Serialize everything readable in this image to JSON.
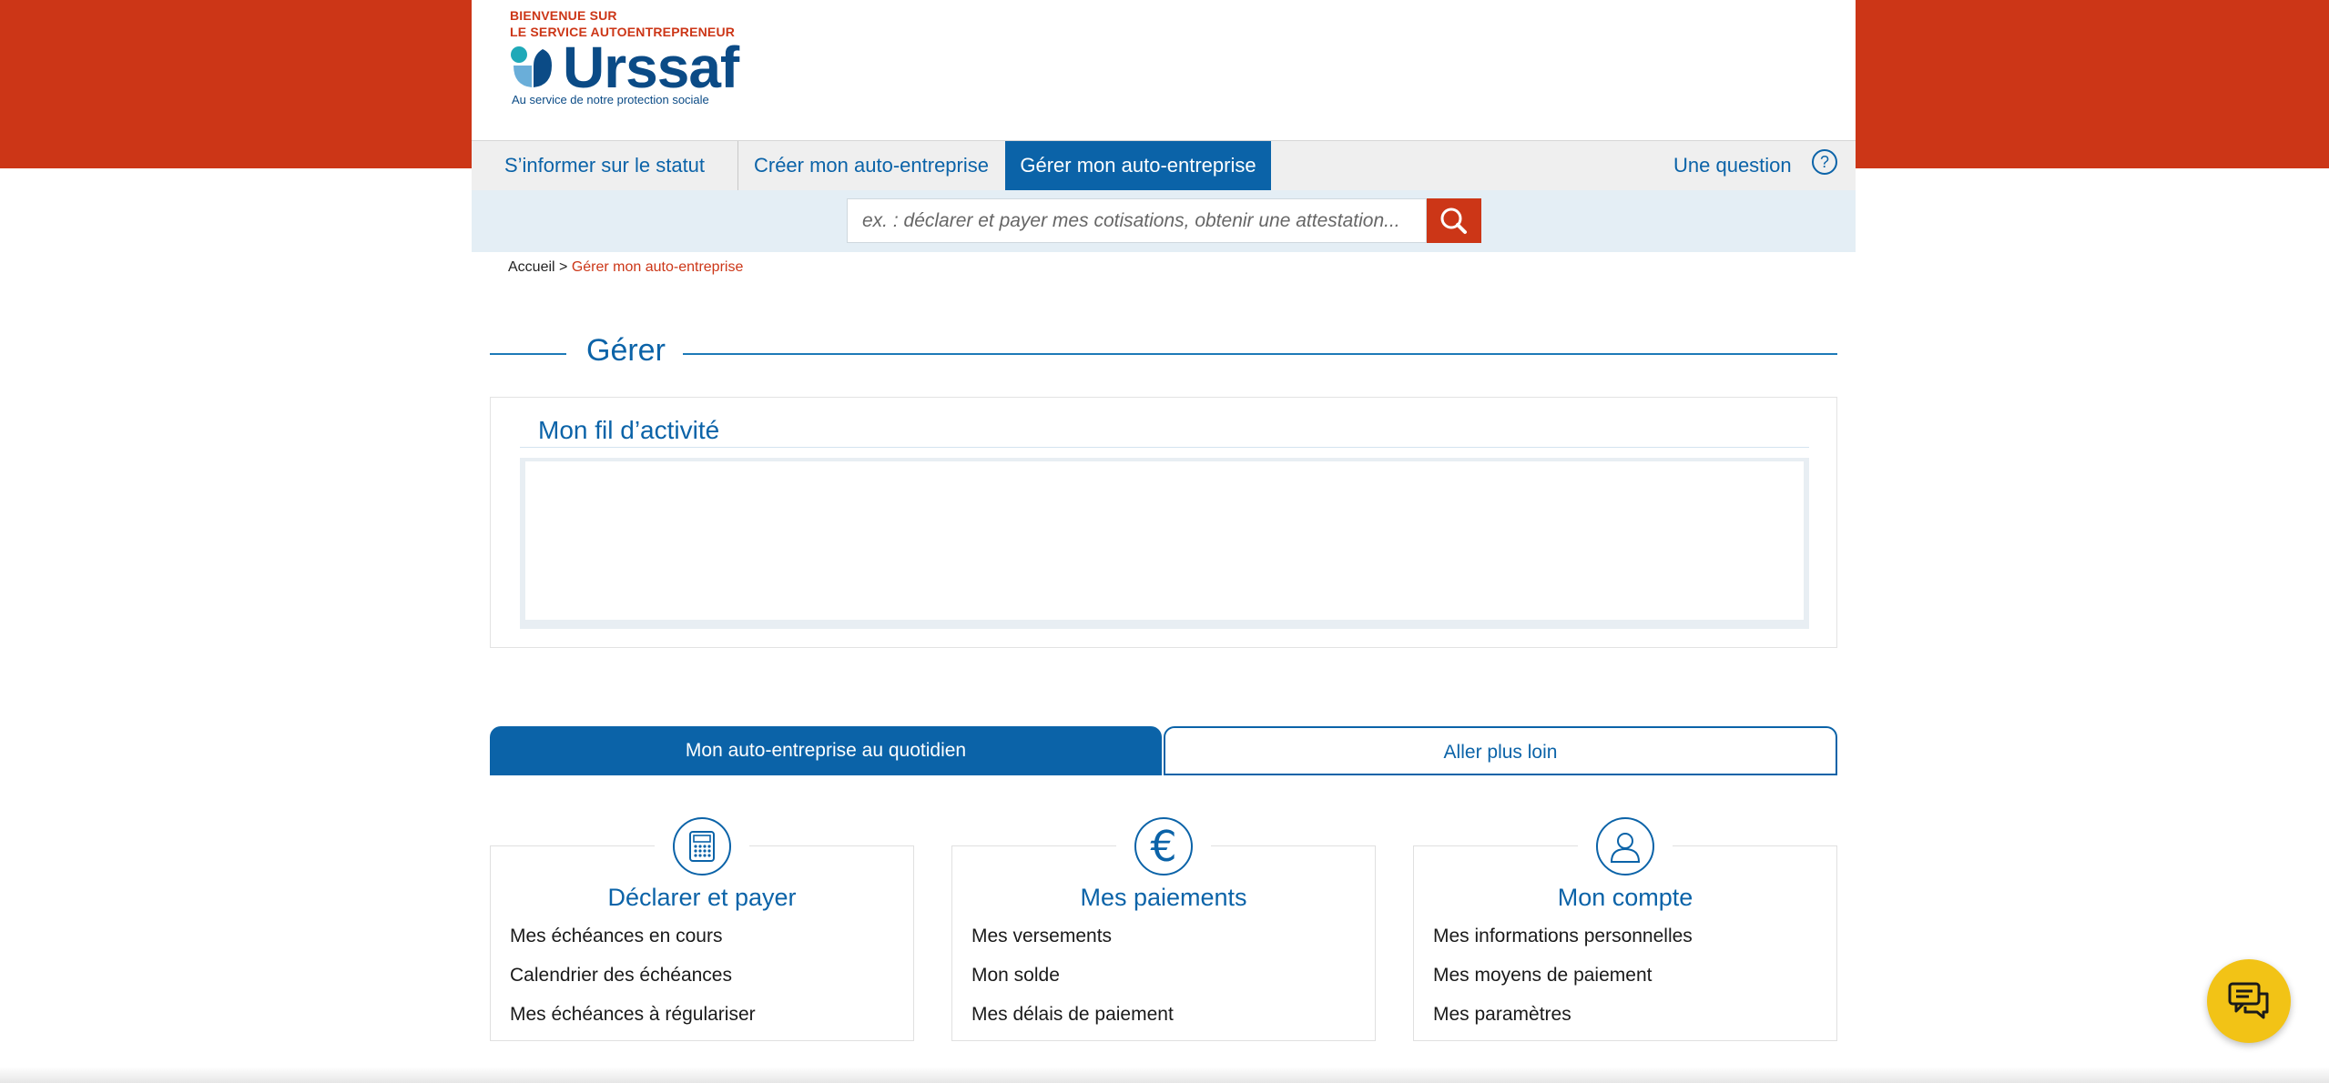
{
  "colors": {
    "brand_red": "#cc3617",
    "brand_blue": "#0b63a8",
    "chat_yellow": "#f2c316"
  },
  "header": {
    "welcome_line1": "BIENVENUE SUR",
    "welcome_line2": "LE SERVICE AUTOENTREPRENEUR",
    "logo_text": "Urssaf",
    "logo_tagline": "Au service de notre protection sociale"
  },
  "nav": {
    "items": [
      {
        "label": "S’informer sur le statut"
      },
      {
        "label": "Créer mon auto-entreprise"
      },
      {
        "label": "Gérer mon auto-entreprise",
        "active": true
      }
    ],
    "help_label": "Une question",
    "help_icon": "question-circle-icon"
  },
  "search": {
    "placeholder": "ex. : déclarer et payer mes cotisations, obtenir une attestation...",
    "icon": "search-icon"
  },
  "breadcrumb": {
    "home": "Accueil",
    "separator": ">",
    "current": "Gérer mon auto-entreprise"
  },
  "main": {
    "section_title": "Gérer",
    "activity_title": "Mon fil d’activité"
  },
  "tabs": [
    {
      "label": "Mon auto-entreprise au quotidien",
      "active": true
    },
    {
      "label": "Aller plus loin",
      "active": false
    }
  ],
  "cards": [
    {
      "icon": "calculator-icon",
      "title": "Déclarer et payer",
      "links": [
        "Mes échéances en cours",
        "Calendrier des échéances",
        "Mes échéances à régulariser"
      ]
    },
    {
      "icon": "euro-icon",
      "title": "Mes paiements",
      "links": [
        "Mes versements",
        "Mon solde",
        "Mes délais de paiement"
      ]
    },
    {
      "icon": "user-icon",
      "title": "Mon compte",
      "links": [
        "Mes informations personnelles",
        "Mes moyens de paiement",
        "Mes paramètres"
      ]
    }
  ],
  "chat": {
    "icon": "chat-icon"
  }
}
